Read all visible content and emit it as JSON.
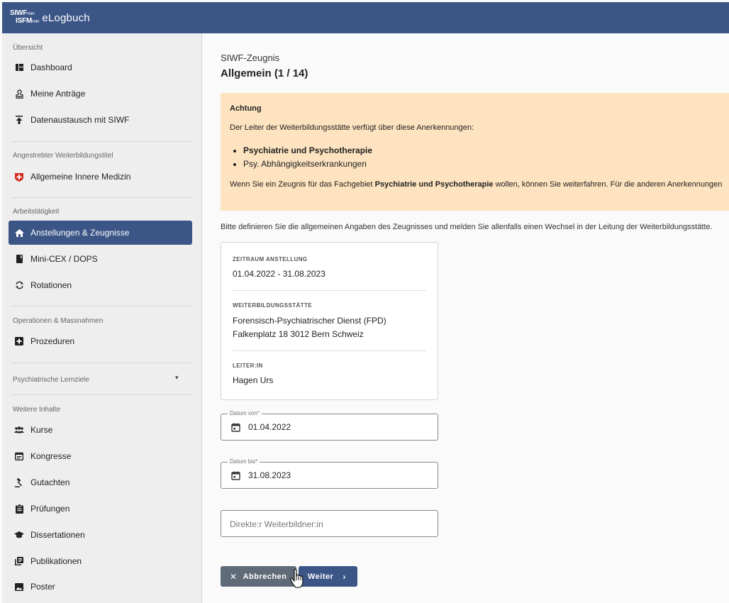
{
  "app": {
    "logo_line1": "SIWF",
    "logo_small1": "FMH",
    "logo_line2": "ISFM",
    "logo_small2": "FMH",
    "name": "eLogbuch"
  },
  "sidebar": {
    "sections": [
      {
        "title": "Übersicht"
      },
      {
        "title": "Angestrebter Weiterbildungstitel"
      },
      {
        "title": "Arbeitstätigkeit"
      },
      {
        "title": "Operationen & Massnahmen"
      },
      {
        "title": "Psychiatrische Lernziele"
      },
      {
        "title": "Weitere Inhalte"
      }
    ],
    "items": [
      {
        "label": "Dashboard",
        "icon": "dashboard-icon"
      },
      {
        "label": "Meine Anträge",
        "icon": "stamp-icon"
      },
      {
        "label": "Datenaustausch mit SIWF",
        "icon": "upload-icon"
      },
      {
        "label": "Allgemeine Innere Medizin",
        "icon": "swiss-cross-icon"
      },
      {
        "label": "Anstellungen & Zeugnisse",
        "icon": "home-icon",
        "active": true
      },
      {
        "label": "Mini-CEX / DOPS",
        "icon": "book-icon"
      },
      {
        "label": "Rotationen",
        "icon": "rotate-icon"
      },
      {
        "label": "Prozeduren",
        "icon": "plus-box-icon"
      },
      {
        "label": "Kurse",
        "icon": "group-icon"
      },
      {
        "label": "Kongresse",
        "icon": "calendar-icon"
      },
      {
        "label": "Gutachten",
        "icon": "gavel-icon"
      },
      {
        "label": "Prüfungen",
        "icon": "clipboard-icon"
      },
      {
        "label": "Dissertationen",
        "icon": "graduation-cap-icon"
      },
      {
        "label": "Publikationen",
        "icon": "publications-icon"
      },
      {
        "label": "Poster",
        "icon": "image-icon"
      }
    ]
  },
  "main": {
    "crumb": "SIWF-Zeugnis",
    "heading": "Allgemein (1 / 14)",
    "alert": {
      "title": "Achtung",
      "text": "Der Leiter der Weiterbildungsstätte verfügt über diese Anerkennungen:",
      "list": [
        "Psychiatrie und Psychotherapie",
        "Psy. Abhängigkeitserkrankungen"
      ],
      "foot_pre": "Wenn Sie ein Zeugnis für das Fachgebiet ",
      "foot_bold": "Psychiatrie und Psychotherapie",
      "foot_post": " wollen, können Sie weiterfahren. Für die anderen Anerkennungen"
    },
    "intro": "Bitte definieren Sie die allgemeinen Angaben des Zeugnisses und melden Sie allenfalls einen Wechsel in der Leitung der Weiterbildungsstätte.",
    "card": {
      "zeitraum_label": "ZEITRAUM ANSTELLUNG",
      "zeitraum_value": "01.04.2022 - 31.08.2023",
      "staette_label": "WEITERBILDUNGSSTÄTTE",
      "staette_line1": "Forensisch-Psychiatrischer Dienst (FPD)",
      "staette_line2": "Falkenplatz 18 3012 Bern Schweiz",
      "leiter_label": "LEITER:IN",
      "leiter_value": "Hagen Urs"
    },
    "fields": {
      "von_label": "Datum von*",
      "von_value": "01.04.2022",
      "bis_label": "Datum bis*",
      "bis_value": "31.08.2023",
      "direkt_placeholder": "Direkte:r Weiterbildner:in"
    },
    "buttons": {
      "cancel": "Abbrechen",
      "next": "Weiter"
    }
  }
}
